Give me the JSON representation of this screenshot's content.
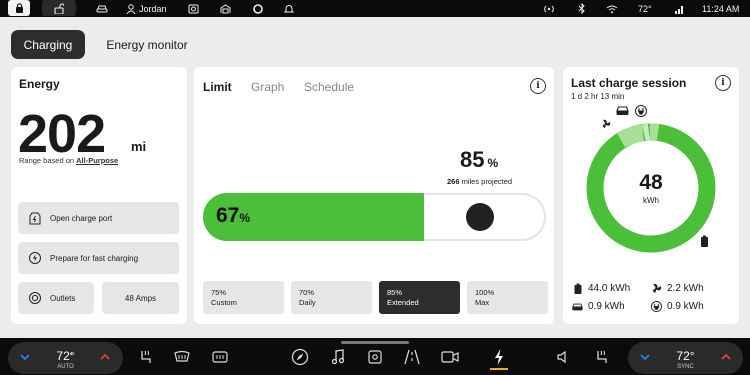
{
  "status_bar": {
    "user_name": "Jordan",
    "temperature": "72°",
    "time": "11:24 AM",
    "icons": [
      "lock-icon",
      "unlock-icon",
      "car-icon",
      "user-icon",
      "camera-icon",
      "garage-icon",
      "circle-app-icon",
      "bell-icon",
      "signal-icon",
      "bluetooth-icon",
      "wifi-icon",
      "cellular-icon"
    ]
  },
  "tabs": {
    "charging": "Charging",
    "energy_monitor": "Energy monitor"
  },
  "energy": {
    "title": "Energy",
    "range_value": "202",
    "range_unit": "mi",
    "range_basis_prefix": "Range based on ",
    "range_basis_link": "All-Purpose",
    "open_port": "Open charge port",
    "prepare_fast": "Prepare for fast charging",
    "outlets": "Outlets",
    "amps": "48 Amps"
  },
  "limit": {
    "tabs": [
      "Limit",
      "Graph",
      "Schedule"
    ],
    "target_percent": "85",
    "target_unit": "%",
    "projected_miles": "266",
    "projected_suffix": " miles projected",
    "current_percent": "67",
    "current_unit": "%",
    "current_fill_fraction": 0.67,
    "presets": [
      {
        "value": "75%",
        "label": "Custom",
        "selected": false
      },
      {
        "value": "70%",
        "label": "Daily",
        "selected": false
      },
      {
        "value": "85%",
        "label": "Extended",
        "selected": true
      },
      {
        "value": "100%",
        "label": "Max",
        "selected": false
      }
    ]
  },
  "session": {
    "title": "Last charge session",
    "duration": "1 d 2 hr 13 min",
    "total_value": "48",
    "total_unit": "kWh",
    "stats": [
      {
        "icon": "battery-icon",
        "value": "44.0 kWh"
      },
      {
        "icon": "fan-icon",
        "value": "2.2 kWh"
      },
      {
        "icon": "car-icon",
        "value": "0.9 kWh"
      },
      {
        "icon": "plug-icon",
        "value": "0.9 kWh"
      }
    ],
    "breakdown_kwh": {
      "battery": 44.0,
      "climate": 2.2,
      "vehicle": 0.9,
      "plug": 0.9
    }
  },
  "bottom_bar": {
    "left_temp": "72°",
    "left_mode": "AUTO",
    "right_temp": "72°",
    "right_mode": "SYNC"
  },
  "colors": {
    "accent_green": "#4cbf3a",
    "light_green": "#a6df97",
    "dark_tile": "#2d2d2d",
    "active_indicator": "#f5a623",
    "arrow_blue": "#2d7ff9",
    "arrow_red": "#e0443a"
  }
}
